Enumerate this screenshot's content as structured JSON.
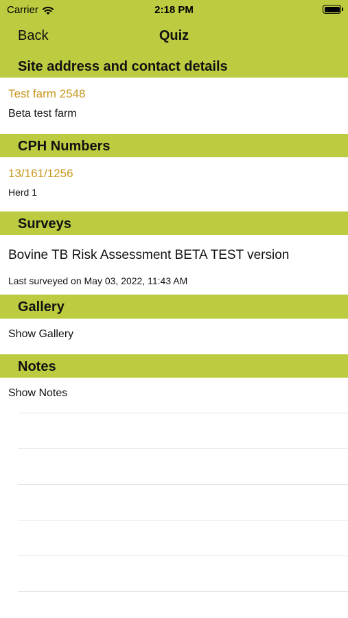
{
  "colors": {
    "accent": "#bccb40",
    "link": "#c8961d"
  },
  "status_bar": {
    "carrier": "Carrier",
    "time": "2:18 PM",
    "wifi_icon": "wifi-icon",
    "battery_icon": "battery-icon"
  },
  "nav": {
    "back_label": "Back",
    "title": "Quiz"
  },
  "site": {
    "header": "Site address and contact details",
    "name": "Test farm 2548",
    "description": "Beta test farm"
  },
  "cph": {
    "header": "CPH Numbers",
    "number": "13/161/1256",
    "herd": "Herd 1"
  },
  "surveys": {
    "header": "Surveys",
    "title": "Bovine TB Risk Assessment BETA TEST version",
    "last_surveyed": "Last surveyed on May 03, 2022, 11:43 AM"
  },
  "gallery": {
    "header": "Gallery",
    "show": "Show Gallery"
  },
  "notes": {
    "header": "Notes",
    "show": "Show Notes"
  }
}
